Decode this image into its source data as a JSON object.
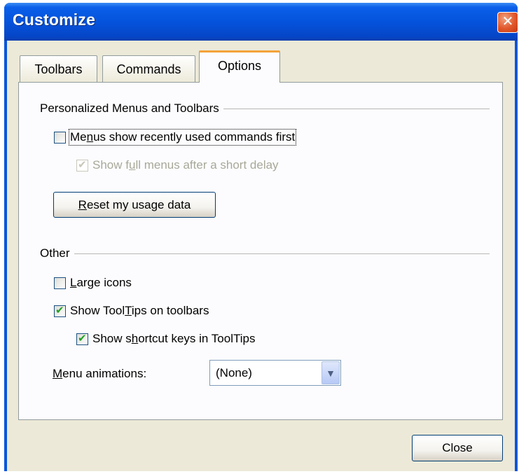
{
  "window": {
    "title": "Customize",
    "close_glyph": "✕"
  },
  "tabs": [
    {
      "label": "Toolbars",
      "active": false
    },
    {
      "label": "Commands",
      "active": false
    },
    {
      "label": "Options",
      "active": true
    }
  ],
  "groups": {
    "personalized": {
      "label": "Personalized Menus and Toolbars",
      "menus_recent": {
        "pre": "Me",
        "accel": "n",
        "post": "us show recently used commands first",
        "checked": false
      },
      "full_menus": {
        "pre": "Show f",
        "accel": "u",
        "post": "ll menus after a short delay",
        "checked": true,
        "disabled": true
      },
      "reset_button": {
        "pre": "",
        "accel": "R",
        "post": "eset my usage data"
      }
    },
    "other": {
      "label": "Other",
      "large_icons": {
        "pre": "",
        "accel": "L",
        "post": "arge icons",
        "checked": false
      },
      "show_tooltips": {
        "pre": "Show Tool",
        "accel": "T",
        "post": "ips on toolbars",
        "checked": true
      },
      "shortcut_keys": {
        "pre": "Show s",
        "accel": "h",
        "post": "ortcut keys in ToolTips",
        "checked": true
      },
      "menu_animations": {
        "label_pre": "",
        "label_accel": "M",
        "label_post": "enu animations:",
        "value": "(None)"
      }
    }
  },
  "footer": {
    "close_label": "Close"
  },
  "colors": {
    "titlebar": "#0553dc",
    "dialog_bg": "#ece9d8",
    "active_tab_accent": "#f4a33a",
    "check_green": "#21a121",
    "close_red": "#e0572b"
  },
  "icons": {
    "dropdown": "chevron-down-icon",
    "close": "close-icon",
    "check": "checkmark-icon"
  }
}
